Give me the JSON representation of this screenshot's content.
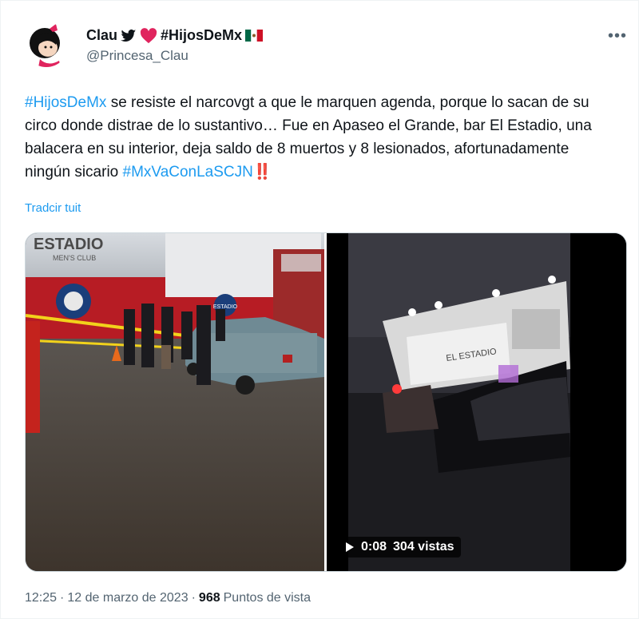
{
  "author": {
    "display_name": "Clau",
    "display_hashtag": "#HijosDeMx",
    "handle": "@Princesa_Clau",
    "avatar_icon": "mafalda-avatar-icon"
  },
  "tweet": {
    "parts": {
      "tag1": "#HijosDeMx",
      "body": " se resiste el narcovgt a que le marquen agenda, porque lo sacan de su circo donde distrae de lo sustantivo… Fue en Apaseo el Grande, bar El Estadio, una balacera en su interior, deja saldo de 8 muertos y 8 lesionados, afortunadamente ningún sicario ",
      "tag2": "#MxVaConLaSCJN",
      "alarm": "‼️"
    },
    "translate_link": "Tradcir tuit"
  },
  "media": {
    "photo_sign": "ESTADIO",
    "photo_sign_sub": "MEN'S CLUB",
    "photo_badge": "ESTADIO",
    "video_sign": "EL ESTADIO",
    "video_duration": "0:08",
    "video_views": "304 vistas"
  },
  "meta": {
    "time": "12:25",
    "date": "12 de marzo de 2023",
    "views_count": "968",
    "views_label": "Puntos de vista"
  },
  "colors": {
    "link": "#1d9bf0",
    "muted": "#536471",
    "heart": "#e0245e"
  }
}
